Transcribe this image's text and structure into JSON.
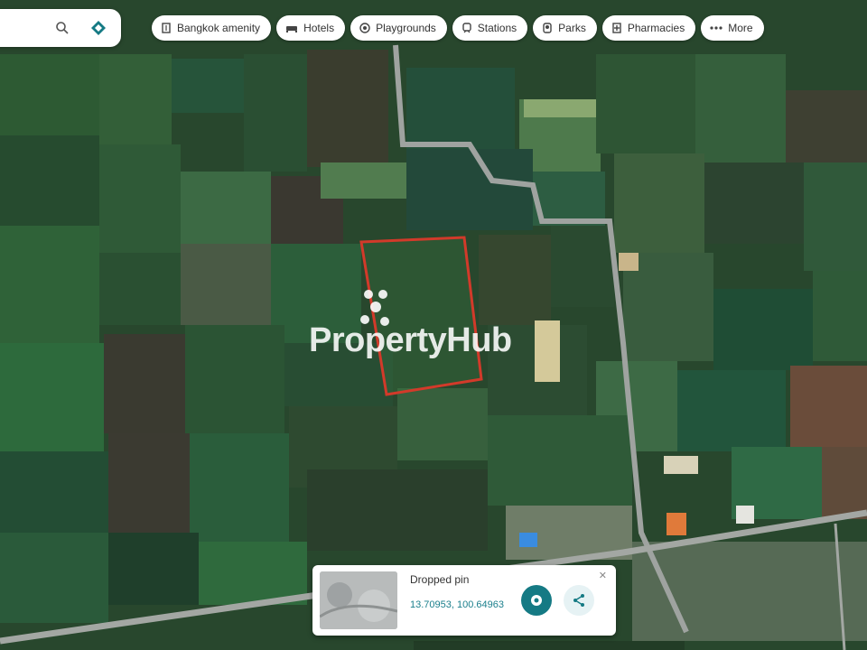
{
  "map": {
    "type": "satellite",
    "watermark": "PropertyHub",
    "colors": {
      "boundary": "#d23a2a",
      "road": "#9fa3a0",
      "accent": "#157a84"
    }
  },
  "search": {
    "placeholder": "",
    "icons": [
      "search-icon",
      "layers-icon"
    ]
  },
  "chips": [
    {
      "label": "Bangkok amenity",
      "icon": "building-icon"
    },
    {
      "label": "Hotels",
      "icon": "bed-icon"
    },
    {
      "label": "Playgrounds",
      "icon": "playground-icon"
    },
    {
      "label": "Stations",
      "icon": "train-icon"
    },
    {
      "label": "Parks",
      "icon": "tree-icon"
    },
    {
      "label": "Pharmacies",
      "icon": "pharmacy-icon"
    },
    {
      "label": "More",
      "icon": "more-icon"
    }
  ],
  "card": {
    "title": "Dropped pin",
    "coordinates": "13.70953, 100.64963",
    "close": "✕",
    "buttons": [
      "directions-icon",
      "share-icon"
    ]
  }
}
